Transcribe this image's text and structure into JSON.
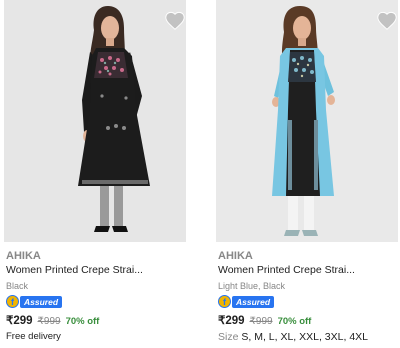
{
  "colors": {
    "accent": "#2874f0",
    "discount": "#388e3c",
    "muted": "#878787",
    "wishlist": "#c2c2c2"
  },
  "products": [
    {
      "brand": "AHIKA",
      "title": "Women Printed Crepe Strai...",
      "color": "Black",
      "assured": "Assured",
      "price": "₹299",
      "mrp": "₹999",
      "discount": "70% off",
      "extra": "Free delivery",
      "wishlist_icon": "heart-icon"
    },
    {
      "brand": "AHIKA",
      "title": "Women Printed Crepe Strai...",
      "color": "Light Blue, Black",
      "assured": "Assured",
      "price": "₹299",
      "mrp": "₹999",
      "discount": "70% off",
      "sizes_label": "Size",
      "sizes": "S, M, L, XL, XXL, 3XL, 4XL",
      "wishlist_icon": "heart-icon"
    }
  ]
}
